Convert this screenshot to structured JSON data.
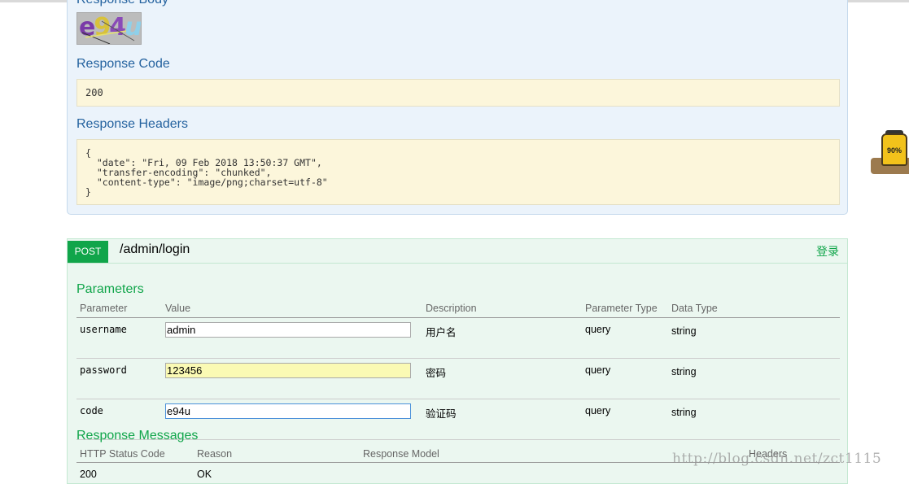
{
  "get_response": {
    "body_heading": "Response Body",
    "captcha_text": "e94u",
    "code_heading": "Response Code",
    "code_value": "200",
    "headers_heading": "Response Headers",
    "headers_text": "{\n  \"date\": \"Fri, 09 Feb 2018 13:50:37 GMT\",\n  \"transfer-encoding\": \"chunked\",\n  \"content-type\": \"image/png;charset=utf-8\"\n}"
  },
  "post": {
    "method": "POST",
    "path": "/admin/login",
    "summary": "登录",
    "parameters_heading": "Parameters",
    "columns": [
      "Parameter",
      "Value",
      "Description",
      "Parameter Type",
      "Data Type"
    ],
    "params": [
      {
        "name": "username",
        "value": "admin",
        "description": "用户名",
        "type": "query",
        "data_type": "string"
      },
      {
        "name": "password",
        "value": "123456",
        "description": "密码",
        "type": "query",
        "data_type": "string"
      },
      {
        "name": "code",
        "value": "e94u",
        "description": "验证码",
        "type": "query",
        "data_type": "string"
      }
    ],
    "response_messages_heading": "Response Messages",
    "response_columns": [
      "HTTP Status Code",
      "Reason",
      "Response Model",
      "Headers"
    ],
    "response_rows": [
      {
        "code": "200",
        "reason": "OK"
      }
    ]
  },
  "widget": {
    "percent": "90%"
  },
  "watermark": "http://blog.csdn.net/zct1115",
  "colors": {
    "get_bg": "#ebf3fb",
    "post_bg": "#ebf7f0",
    "post_accent": "#10a54a",
    "heading_blue": "#24629f"
  }
}
